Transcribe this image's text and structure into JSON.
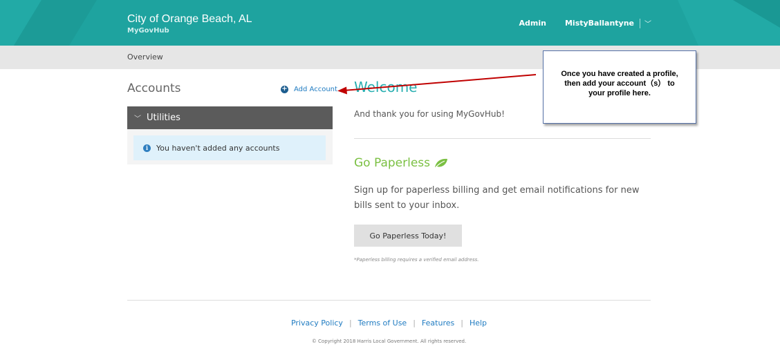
{
  "header": {
    "city": "City of Orange Beach, AL",
    "app_name": "MyGovHub",
    "admin_label": "Admin",
    "user_name": "MistyBallantyne",
    "chevron": "﹀"
  },
  "subnav": {
    "breadcrumb": "Overview"
  },
  "accounts": {
    "title": "Accounts",
    "add_label": "Add Account",
    "add_icon": "+",
    "group": {
      "chevron": "﹀",
      "label": "Utilities"
    },
    "info_icon": "i",
    "empty_message": "You haven't added any accounts"
  },
  "main": {
    "welcome": "Welcome",
    "thanks": "And thank you for using MyGovHub!",
    "paperless_title": "Go Paperless",
    "paperless_text": "Sign up for paperless billing and get email notifications for new bills sent to your inbox.",
    "paperless_button": "Go Paperless Today!",
    "paperless_note": "*Paperless billing requires a verified email address."
  },
  "footer": {
    "links": [
      "Privacy Policy",
      "Terms of Use",
      "Features",
      "Help"
    ],
    "separator": "|",
    "copyright": "© Copyright 2018 Harris Local Government. All rights reserved."
  },
  "callout": {
    "lines": [
      "Once you have created a profile,",
      "then add your account（s） to",
      "your profile here."
    ]
  },
  "colors": {
    "header_teal": "#1ea39f",
    "welcome_teal": "#27aeb0",
    "paperless_green": "#7bc043",
    "link_blue": "#1f7bc1",
    "utilities_header": "#5b5b5b",
    "info_bg": "#dff1fb",
    "arrow_red": "#c00000"
  }
}
